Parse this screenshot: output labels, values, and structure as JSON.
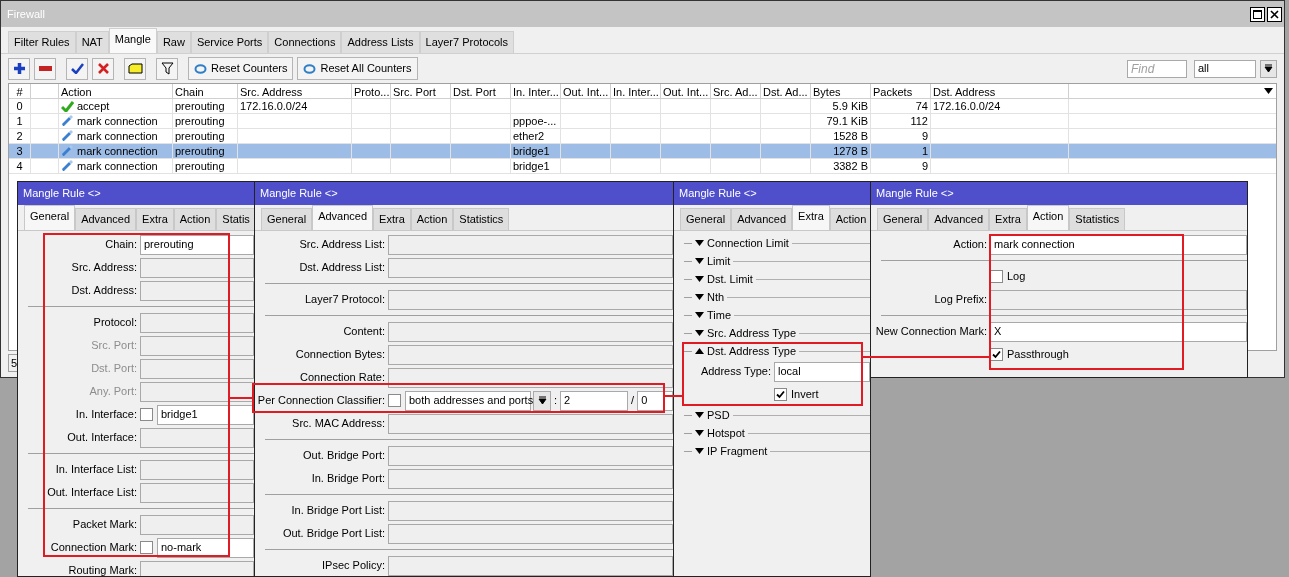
{
  "window": {
    "title": "Firewall"
  },
  "tabs": [
    {
      "label": "Filter Rules",
      "selected": false
    },
    {
      "label": "NAT",
      "selected": false
    },
    {
      "label": "Mangle",
      "selected": true
    },
    {
      "label": "Raw",
      "selected": false
    },
    {
      "label": "Service Ports",
      "selected": false
    },
    {
      "label": "Connections",
      "selected": false
    },
    {
      "label": "Address Lists",
      "selected": false
    },
    {
      "label": "Layer7 Protocols",
      "selected": false
    }
  ],
  "toolbar": {
    "buttons": [
      "Reset Counters",
      "Reset All Counters"
    ],
    "find": {
      "placeholder": "Find"
    },
    "filter": {
      "value": "all"
    }
  },
  "table": {
    "columns": [
      "#",
      "Action",
      "Chain",
      "Src. Address",
      "Proto...",
      "Src. Port",
      "Dst. Port",
      "In. Inter...",
      "Out. Int...",
      "In. Inter...",
      "Out. Int...",
      "Src. Ad...",
      "Dst. Ad...",
      "Bytes",
      "Packets",
      "Dst. Address"
    ],
    "rows": [
      {
        "kind": "accept",
        "selected": false,
        "cells": [
          "0",
          "accept",
          "prerouting",
          "172.16.0.0/24",
          null,
          null,
          null,
          null,
          null,
          null,
          null,
          null,
          null,
          "5.9 KiB",
          "74",
          "172.16.0.0/24"
        ]
      },
      {
        "kind": "mark",
        "selected": false,
        "cells": [
          "1",
          "mark connection",
          "prerouting",
          null,
          null,
          null,
          null,
          "pppoe-...",
          null,
          null,
          null,
          null,
          null,
          "79.1 KiB",
          "112",
          null
        ]
      },
      {
        "kind": "mark",
        "selected": false,
        "cells": [
          "2",
          "mark connection",
          "prerouting",
          null,
          null,
          null,
          null,
          "ether2",
          null,
          null,
          null,
          null,
          null,
          "1528 B",
          "9",
          null
        ]
      },
      {
        "kind": "mark",
        "selected": true,
        "cells": [
          "3",
          "mark connection",
          "prerouting",
          null,
          null,
          null,
          null,
          "bridge1",
          null,
          null,
          null,
          null,
          null,
          "1278 B",
          "1",
          null
        ]
      },
      {
        "kind": "mark",
        "selected": false,
        "cells": [
          "4",
          "mark connection",
          "prerouting",
          null,
          null,
          null,
          null,
          "bridge1",
          null,
          null,
          null,
          null,
          null,
          "3382 B",
          "9",
          null
        ]
      }
    ]
  },
  "status_bar": "5",
  "rule_windows": [
    {
      "title": "Mangle Rule <>",
      "kind": "form",
      "tabs": [
        {
          "label": "General",
          "selected": true
        },
        {
          "label": "Advanced",
          "selected": false
        },
        {
          "label": "Extra",
          "selected": false
        },
        {
          "label": "Action",
          "selected": false
        },
        {
          "label": "Statis",
          "selected": false
        }
      ],
      "groups": [
        [
          {
            "kind": "text",
            "label": "Chain:",
            "value": "prerouting",
            "dimmed": false
          },
          {
            "kind": "text",
            "label": "Src. Address:",
            "dimmed": false
          },
          {
            "kind": "text",
            "label": "Dst. Address:",
            "dimmed": false
          }
        ],
        [
          {
            "kind": "text",
            "label": "Protocol:",
            "dimmed": false
          },
          {
            "kind": "text",
            "label": "Src. Port:",
            "dimmed": true
          },
          {
            "kind": "text",
            "label": "Dst. Port:",
            "dimmed": true
          },
          {
            "kind": "text",
            "label": "Any. Port:",
            "dimmed": true
          },
          {
            "kind": "text",
            "label": "In. Interface:",
            "value": "bridge1",
            "checked": false,
            "dimmed": false
          },
          {
            "kind": "text",
            "label": "Out. Interface:",
            "dimmed": false
          }
        ],
        [
          {
            "kind": "text",
            "label": "In. Interface List:",
            "dimmed": false
          },
          {
            "kind": "text",
            "label": "Out. Interface List:",
            "dimmed": false
          }
        ],
        [
          {
            "kind": "text",
            "label": "Packet Mark:",
            "dimmed": false
          },
          {
            "kind": "text",
            "label": "Connection Mark:",
            "value": "no-mark",
            "checked": false,
            "dimmed": false
          },
          {
            "kind": "text",
            "label": "Routing Mark:",
            "dimmed": false
          }
        ]
      ]
    },
    {
      "title": "Mangle Rule <>",
      "kind": "form",
      "tabs": [
        {
          "label": "General",
          "selected": false
        },
        {
          "label": "Advanced",
          "selected": true
        },
        {
          "label": "Extra",
          "selected": false
        },
        {
          "label": "Action",
          "selected": false
        },
        {
          "label": "Statistics",
          "selected": false
        }
      ],
      "groups": [
        [
          {
            "kind": "text",
            "label": "Src. Address List:",
            "dimmed": false
          },
          {
            "kind": "text",
            "label": "Dst. Address List:",
            "dimmed": false
          }
        ],
        [
          {
            "kind": "text",
            "label": "Layer7 Protocol:",
            "dimmed": false
          }
        ],
        [
          {
            "kind": "text",
            "label": "Content:",
            "dimmed": false
          },
          {
            "kind": "text",
            "label": "Connection Bytes:",
            "dimmed": false
          },
          {
            "kind": "text",
            "label": "Connection Rate:",
            "dimmed": false
          },
          {
            "kind": "classifier",
            "label": "Per Connection Classifier:",
            "checked": false,
            "value": "both addresses and ports",
            "separator_1": ":",
            "count": "2",
            "separator_2": "/",
            "index": "0"
          },
          {
            "kind": "text",
            "label": "Src. MAC Address:",
            "dimmed": false
          }
        ],
        [
          {
            "kind": "text",
            "label": "Out. Bridge Port:",
            "dimmed": false
          },
          {
            "kind": "text",
            "label": "In. Bridge Port:",
            "dimmed": false
          }
        ],
        [
          {
            "kind": "text",
            "label": "In. Bridge Port List:",
            "dimmed": false
          },
          {
            "kind": "text",
            "label": "Out. Bridge Port List:",
            "dimmed": false
          }
        ],
        [
          {
            "kind": "text",
            "label": "IPsec Policy:",
            "dimmed": false
          }
        ]
      ]
    },
    {
      "title": "Mangle Rule <>",
      "kind": "sections",
      "tabs": [
        {
          "label": "General",
          "selected": false
        },
        {
          "label": "Advanced",
          "selected": false
        },
        {
          "label": "Extra",
          "selected": true
        },
        {
          "label": "Action",
          "selected": false
        }
      ],
      "sections": [
        {
          "label": "Connection Limit",
          "expanded": false
        },
        {
          "label": "Limit",
          "expanded": false
        },
        {
          "label": "Dst. Limit",
          "expanded": false
        },
        {
          "label": "Nth",
          "expanded": false
        },
        {
          "label": "Time",
          "expanded": false
        },
        {
          "label": "Src. Address Type",
          "expanded": false
        },
        {
          "label": "Dst. Address Type",
          "expanded": true,
          "fields": [
            {
              "kind": "text",
              "label": "Address Type:",
              "value": "local",
              "dimmed": false
            },
            {
              "kind": "check",
              "label": "Invert",
              "checked": true
            }
          ]
        },
        {
          "label": "PSD",
          "expanded": false
        },
        {
          "label": "Hotspot",
          "expanded": false
        },
        {
          "label": "IP Fragment",
          "expanded": false
        }
      ]
    },
    {
      "title": "Mangle Rule <>",
      "kind": "form",
      "tabs": [
        {
          "label": "General",
          "selected": false
        },
        {
          "label": "Advanced",
          "selected": false
        },
        {
          "label": "Extra",
          "selected": false
        },
        {
          "label": "Action",
          "selected": true
        },
        {
          "label": "Statistics",
          "selected": false
        }
      ],
      "groups": [
        [
          {
            "kind": "text",
            "label": "Action:",
            "value": "mark connection",
            "dimmed": false
          }
        ],
        [
          {
            "kind": "check",
            "label": "Log",
            "checked": false
          },
          {
            "kind": "text",
            "label": "Log Prefix:",
            "dimmed": false
          }
        ],
        [
          {
            "kind": "text",
            "label": "New Connection Mark:",
            "value": "X",
            "dimmed": false
          },
          {
            "kind": "check",
            "label": "Passthrough",
            "checked": true
          }
        ]
      ]
    }
  ]
}
